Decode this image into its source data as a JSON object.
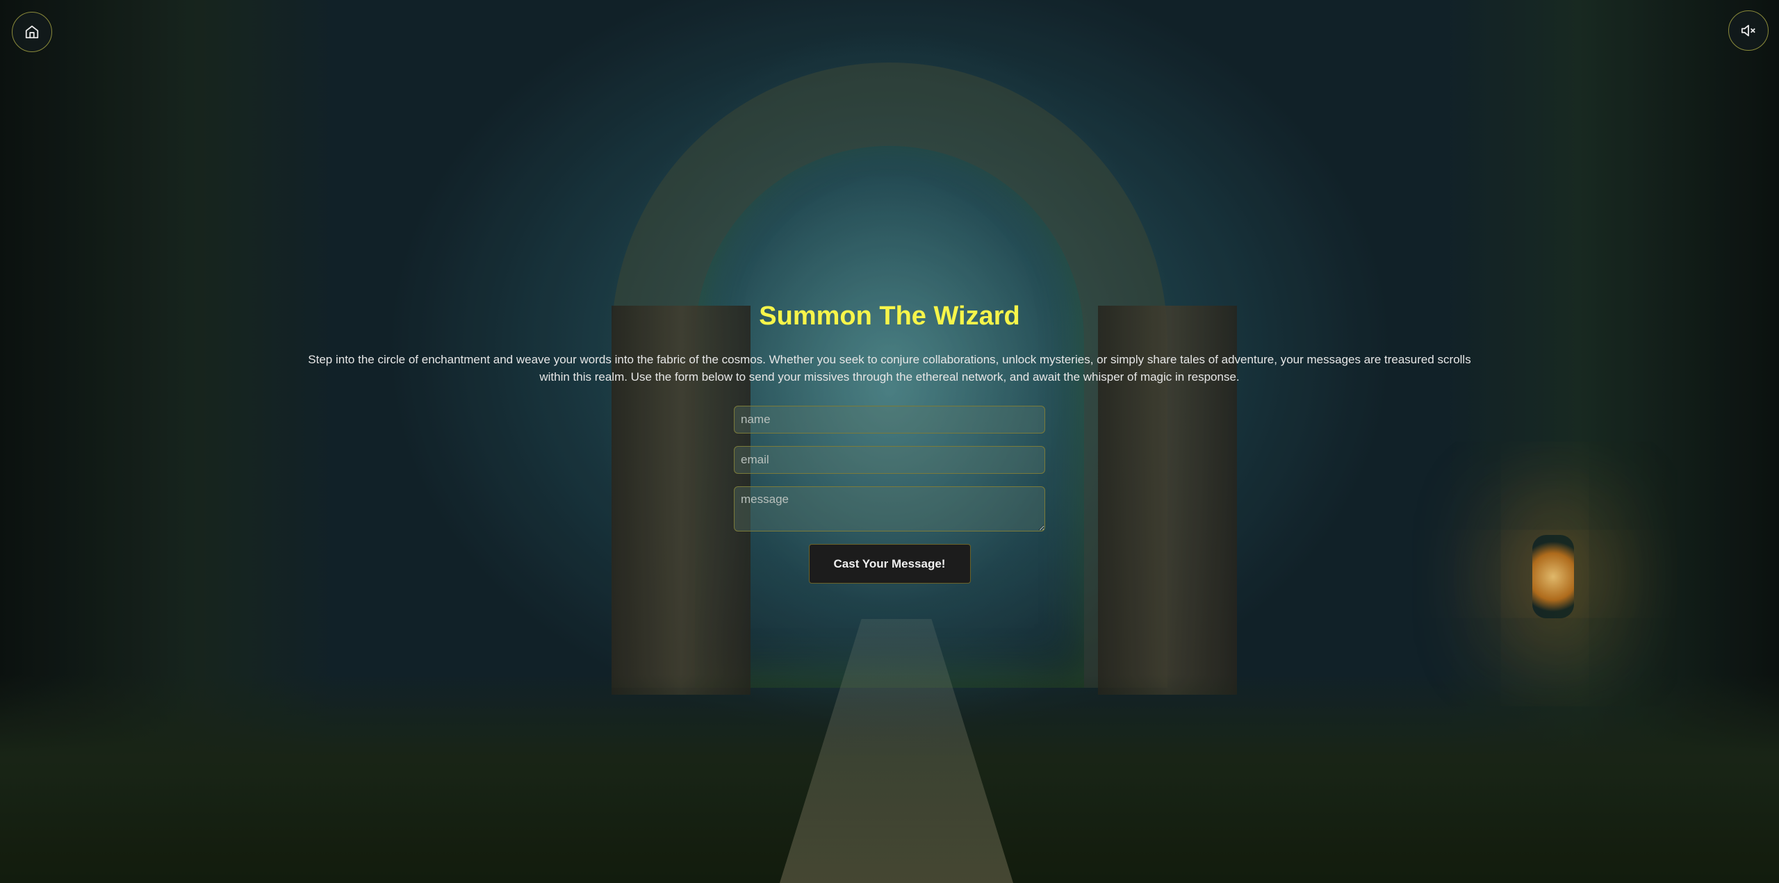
{
  "nav": {
    "home_icon": "home-icon",
    "mute_icon": "volume-mute-icon"
  },
  "contact": {
    "title": "Summon The Wizard",
    "description": "Step into the circle of enchantment and weave your words into the fabric of the cosmos. Whether you seek to conjure collaborations, unlock mysteries, or simply share tales of adventure, your messages are treasured scrolls within this realm. Use the form below to send your missives through the ethereal network, and await the whisper of magic in response.",
    "form": {
      "name_placeholder": "name",
      "name_value": "",
      "email_placeholder": "email",
      "email_value": "",
      "message_placeholder": "message",
      "message_value": "",
      "submit_label": "Cast Your Message!"
    }
  },
  "colors": {
    "title": "#f7f54a",
    "button_bg": "#1c1c1c",
    "border_accent": "#7a7a3a"
  }
}
